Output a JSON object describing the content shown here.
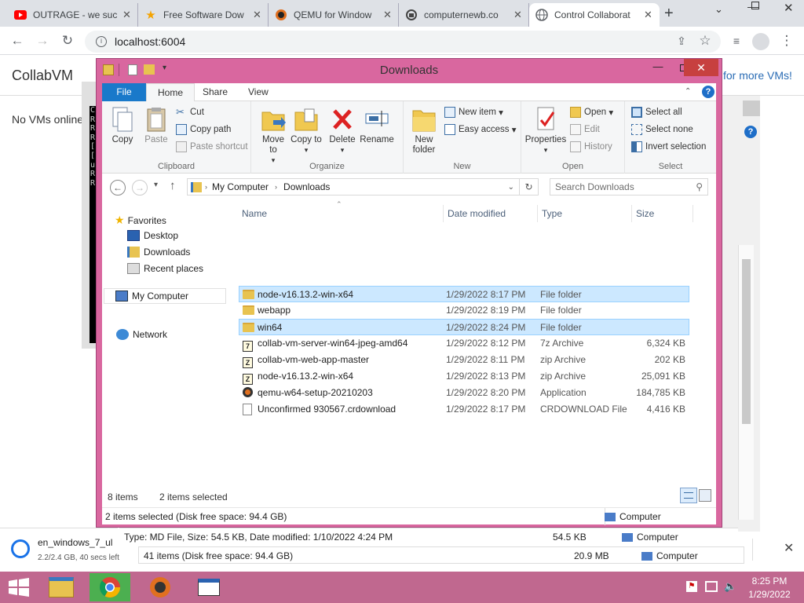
{
  "browser": {
    "tabs": [
      {
        "title": "OUTRAGE - we suc",
        "icon": "youtube-icon"
      },
      {
        "title": "Free Software Dow",
        "icon": "star-icon"
      },
      {
        "title": "QEMU for Window",
        "icon": "qemu-icon"
      },
      {
        "title": "computernewb.co",
        "icon": "site-icon"
      },
      {
        "title": "Control Collaborat",
        "icon": "globe-icon",
        "active": true
      }
    ],
    "new_tab": "+",
    "url": "localhost:6004"
  },
  "page": {
    "site_title": "CollabVM",
    "no_vms": "No VMs online",
    "more_vms": "for more VMs!"
  },
  "cmd_lines": [
    "C",
    "R",
    "R",
    "R",
    "[",
    "[",
    "u",
    "R",
    "R"
  ],
  "explorer": {
    "title": "Downloads",
    "ribbon_tabs": [
      "File",
      "Home",
      "Share",
      "View"
    ],
    "clipboard": {
      "copy": "Copy",
      "paste": "Paste",
      "cut": "Cut",
      "copy_path": "Copy path",
      "paste_shortcut": "Paste shortcut",
      "label": "Clipboard"
    },
    "organize": {
      "move_to": "Move to",
      "copy_to": "Copy to",
      "delete": "Delete",
      "rename": "Rename",
      "label": "Organize"
    },
    "new": {
      "new_folder": "New folder",
      "new_item": "New item",
      "easy_access": "Easy access",
      "label": "New"
    },
    "open": {
      "properties": "Properties",
      "open": "Open",
      "edit": "Edit",
      "history": "History",
      "label": "Open"
    },
    "select": {
      "select_all": "Select all",
      "select_none": "Select none",
      "invert": "Invert selection",
      "label": "Select"
    },
    "breadcrumb": [
      "My Computer",
      "Downloads"
    ],
    "search_placeholder": "Search Downloads",
    "nav": {
      "favorites": "Favorites",
      "desktop": "Desktop",
      "downloads": "Downloads",
      "recent": "Recent places",
      "computer": "My Computer",
      "network": "Network"
    },
    "columns": [
      "Name",
      "Date modified",
      "Type",
      "Size"
    ],
    "files": [
      {
        "name": "node-v16.13.2-win-x64",
        "date": "1/29/2022 8:17 PM",
        "type": "File folder",
        "size": "",
        "kind": "folder",
        "selected": true
      },
      {
        "name": "webapp",
        "date": "1/29/2022 8:19 PM",
        "type": "File folder",
        "size": "",
        "kind": "folder",
        "selected": false
      },
      {
        "name": "win64",
        "date": "1/29/2022 8:24 PM",
        "type": "File folder",
        "size": "",
        "kind": "folder",
        "selected": true
      },
      {
        "name": "collab-vm-server-win64-jpeg-amd64",
        "date": "1/29/2022 8:12 PM",
        "type": "7z Archive",
        "size": "6,324 KB",
        "kind": "zip",
        "selected": false
      },
      {
        "name": "collab-vm-web-app-master",
        "date": "1/29/2022 8:11 PM",
        "type": "zip Archive",
        "size": "202 KB",
        "kind": "zip",
        "selected": false
      },
      {
        "name": "node-v16.13.2-win-x64",
        "date": "1/29/2022 8:13 PM",
        "type": "zip Archive",
        "size": "25,091 KB",
        "kind": "zip",
        "selected": false
      },
      {
        "name": "qemu-w64-setup-20210203",
        "date": "1/29/2022 8:20 PM",
        "type": "Application",
        "size": "184,785 KB",
        "kind": "app",
        "selected": false
      },
      {
        "name": "Unconfirmed 930567.crdownload",
        "date": "1/29/2022 8:17 PM",
        "type": "CRDOWNLOAD File",
        "size": "4,416 KB",
        "kind": "doc",
        "selected": false
      }
    ],
    "item_count": "8 items",
    "selected_count": "2 items selected",
    "status_detail": "2 items selected (Disk free space: 94.4 GB)",
    "status_location": "Computer"
  },
  "behind": {
    "status1": "Type: MD File, Size: 54.5 KB, Date modified: 1/10/2022 4:24 PM",
    "status1_size": "54.5 KB",
    "status1_loc": "Computer",
    "status2": "41 items (Disk free space: 94.4 GB)",
    "status2_size": "20.9 MB",
    "status2_loc": "Computer"
  },
  "download": {
    "name": "en_windows_7_ul",
    "progress": "2.2/2.4 GB, 40 secs left"
  },
  "clock": {
    "time": "8:25 PM",
    "date": "1/29/2022"
  },
  "colors": {
    "titlebar": "#d9679f",
    "taskbar": "#c0688f",
    "selection": "#cce8ff"
  }
}
